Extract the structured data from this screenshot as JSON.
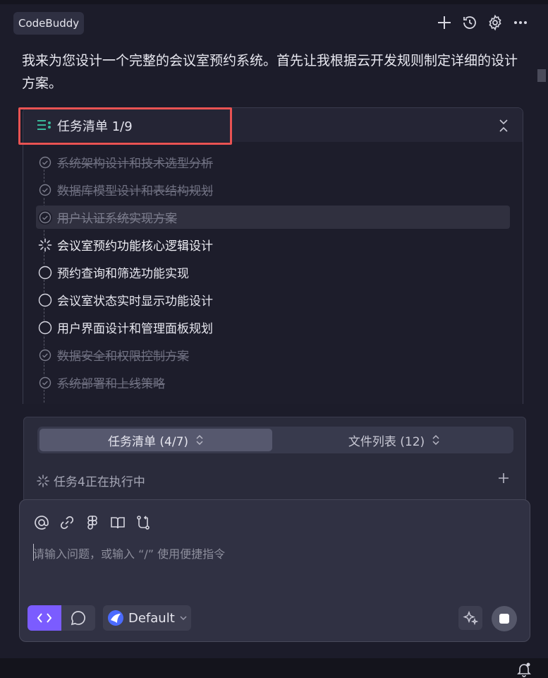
{
  "header": {
    "brand": "CodeBuddy",
    "icons": [
      "plus-icon",
      "history-icon",
      "gear-icon",
      "more-icon"
    ]
  },
  "intro_text": "我来为您设计一个完整的会议室预约系统。首先让我根据云开发规则制定详细的设计方案。",
  "task_list": {
    "title": "任务清单 1/9",
    "items": [
      {
        "label": "系统架构设计和技术选型分析",
        "status": "done"
      },
      {
        "label": "数据库模型设计和表结构规划",
        "status": "done"
      },
      {
        "label": "用户认证系统实现方案",
        "status": "done"
      },
      {
        "label": "会议室预约功能核心逻辑设计",
        "status": "in-progress"
      },
      {
        "label": "预约查询和筛选功能实现",
        "status": "todo"
      },
      {
        "label": "会议室状态实时显示功能设计",
        "status": "todo"
      },
      {
        "label": "用户界面设计和管理面板规划",
        "status": "todo"
      },
      {
        "label": "数据安全和权限控制方案",
        "status": "done"
      },
      {
        "label": "系统部署和上线策略",
        "status": "done"
      }
    ]
  },
  "panel": {
    "tabs": [
      {
        "label": "任务清单 (4/7)",
        "selected": true
      },
      {
        "label": "文件列表 (12)",
        "selected": false
      }
    ],
    "running_status": "任务4正在执行中"
  },
  "composer": {
    "tools": [
      "at-icon",
      "link-icon",
      "figma-icon",
      "book-icon",
      "git-branch-icon"
    ],
    "placeholder": "请输入问题，或输入 “/” 使用便捷指令",
    "model": "Default"
  },
  "colors": {
    "accent": "#7b5cff",
    "highlight_box": "#e95353",
    "list_icon": "#39b89a"
  }
}
